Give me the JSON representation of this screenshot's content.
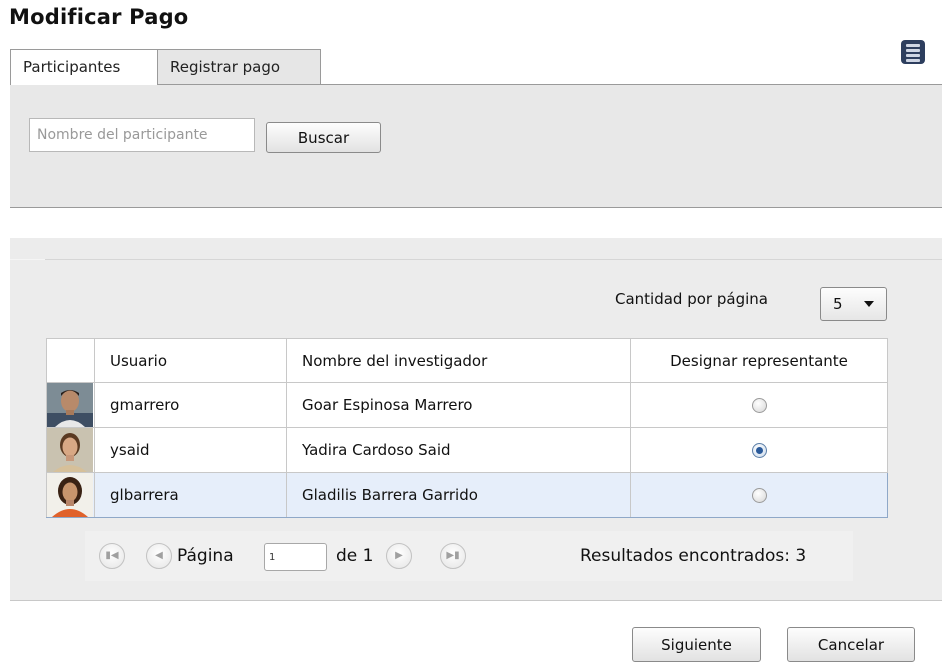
{
  "page": {
    "title": "Modificar Pago"
  },
  "tabs": [
    {
      "label": "Participantes",
      "active": true
    },
    {
      "label": "Registrar pago",
      "active": false
    }
  ],
  "search": {
    "placeholder": "Nombre del participante",
    "value": "",
    "button_label": "Buscar"
  },
  "results": {
    "per_page_label": "Cantidad por página",
    "per_page_value": "5",
    "columns": [
      "",
      "Usuario",
      "Nombre del investigador",
      "Designar representante"
    ],
    "rows": [
      {
        "user": "gmarrero",
        "name": "Goar Espinosa Marrero",
        "representative": false,
        "selected": false
      },
      {
        "user": "ysaid",
        "name": "Yadira Cardoso Said",
        "representative": true,
        "selected": false
      },
      {
        "user": "glbarrera",
        "name": "Gladilis Barrera Garrido",
        "representative": false,
        "selected": true
      }
    ],
    "paginator": {
      "page_label": "Página",
      "current_page": "1",
      "of_label": "de 1",
      "results_text": "Resultados encontrados: 3"
    }
  },
  "actions": {
    "next_label": "Siguiente",
    "cancel_label": "Cancelar"
  },
  "icons": {
    "menu": "list-menu-icon",
    "first": "first-page-icon",
    "prev": "prev-page-icon",
    "next": "next-page-icon",
    "last": "last-page-icon",
    "caret": "chevron-down-icon"
  },
  "colors": {
    "selected_row": "#e6eefa",
    "radio_checked": "#2a5a9a",
    "menu_icon": "#2d3e5e"
  }
}
